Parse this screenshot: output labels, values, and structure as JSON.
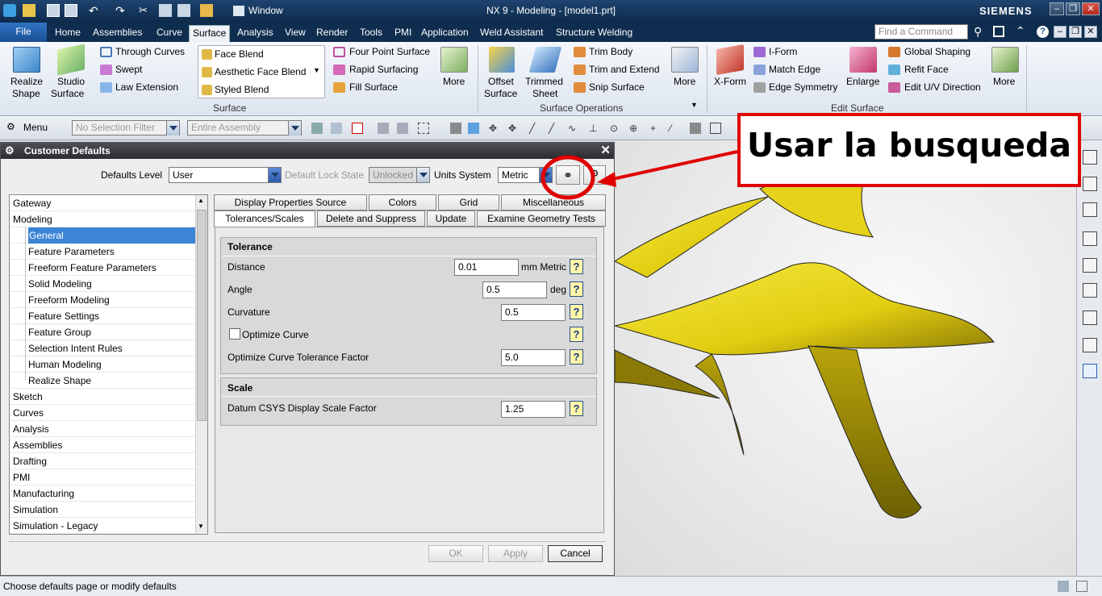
{
  "window": {
    "title": "NX 9 - Modeling - [model1.prt]",
    "brand": "SIEMENS",
    "quick_access_window": "Window"
  },
  "ribbon_tabs": [
    "File",
    "Home",
    "Assemblies",
    "Curve",
    "Surface",
    "Analysis",
    "View",
    "Render",
    "Tools",
    "PMI",
    "Application",
    "Weld Assistant",
    "Structure Welding"
  ],
  "active_tab": "Surface",
  "search": {
    "placeholder": "Find a Command"
  },
  "ribbon": {
    "realize_shape": "Realize",
    "realize_shape_2": "Shape",
    "studio_surface": "Studio",
    "studio_surface_2": "Surface",
    "through_curves": "Through Curves",
    "swept": "Swept",
    "law_extension": "Law Extension",
    "face_blend": "Face Blend",
    "aesthetic_face_blend": "Aesthetic Face Blend",
    "styled_blend": "Styled Blend",
    "four_point_surface": "Four Point Surface",
    "rapid_surfacing": "Rapid Surfacing",
    "fill_surface": "Fill Surface",
    "more1": "More",
    "group_surface": "Surface",
    "offset_surface": "Offset",
    "offset_surface_2": "Surface",
    "trimmed_sheet": "Trimmed",
    "trimmed_sheet_2": "Sheet",
    "trim_body": "Trim Body",
    "trim_and_extend": "Trim and Extend",
    "snip_surface": "Snip Surface",
    "more2": "More",
    "group_surface_operations": "Surface Operations",
    "x_form": "X-Form",
    "i_form": "I-Form",
    "match_edge": "Match Edge",
    "edge_symmetry": "Edge Symmetry",
    "enlarge": "Enlarge",
    "global_shaping": "Global Shaping",
    "refit_face": "Refit Face",
    "edit_uv_direction": "Edit U/V Direction",
    "more3": "More",
    "group_edit_surface": "Edit Surface"
  },
  "toolbar": {
    "menu": "Menu",
    "selection_filter": "No Selection Filter",
    "scope": "Entire Assembly"
  },
  "dialog": {
    "title": "Customer Defaults",
    "defaults_level_label": "Defaults Level",
    "defaults_level_value": "User",
    "lock_state_label": "Default Lock State",
    "lock_state_value": "Unlocked",
    "units_label": "Units System",
    "units_value": "Metric",
    "tree": [
      {
        "label": "Gateway",
        "level": 0
      },
      {
        "label": "Modeling",
        "level": 0
      },
      {
        "label": "General",
        "level": 1,
        "selected": true
      },
      {
        "label": "Feature Parameters",
        "level": 1
      },
      {
        "label": "Freeform Feature Parameters",
        "level": 1
      },
      {
        "label": "Solid Modeling",
        "level": 1
      },
      {
        "label": "Freeform Modeling",
        "level": 1
      },
      {
        "label": "Feature Settings",
        "level": 1
      },
      {
        "label": "Feature Group",
        "level": 1
      },
      {
        "label": "Selection Intent Rules",
        "level": 1
      },
      {
        "label": "Human Modeling",
        "level": 1
      },
      {
        "label": "Realize Shape",
        "level": 1
      },
      {
        "label": "Sketch",
        "level": 0
      },
      {
        "label": "Curves",
        "level": 0
      },
      {
        "label": "Analysis",
        "level": 0
      },
      {
        "label": "Assemblies",
        "level": 0
      },
      {
        "label": "Drafting",
        "level": 0
      },
      {
        "label": "PMI",
        "level": 0
      },
      {
        "label": "Manufacturing",
        "level": 0
      },
      {
        "label": "Simulation",
        "level": 0
      },
      {
        "label": "Simulation - Legacy",
        "level": 0
      }
    ],
    "tabs_row1": [
      "Display Properties Source",
      "Colors",
      "Grid",
      "Miscellaneous"
    ],
    "tabs_row2": [
      "Tolerances/Scales",
      "Delete and Suppress",
      "Update",
      "Examine Geometry Tests"
    ],
    "active_tab": "Tolerances/Scales",
    "tolerance": {
      "title": "Tolerance",
      "distance_label": "Distance",
      "distance_value": "0.01",
      "distance_unit": "mm Metric",
      "angle_label": "Angle",
      "angle_value": "0.5",
      "angle_unit": "deg",
      "curvature_label": "Curvature",
      "curvature_value": "0.5",
      "optimize_curve_label": "Optimize Curve",
      "optimize_factor_label": "Optimize Curve Tolerance Factor",
      "optimize_factor_value": "5.0"
    },
    "scale": {
      "title": "Scale",
      "datum_label": "Datum CSYS Display Scale Factor",
      "datum_value": "1.25"
    },
    "ok": "OK",
    "apply": "Apply",
    "cancel": "Cancel"
  },
  "annotation": {
    "text": "Usar la busqueda",
    "color": "#e00000"
  },
  "status": {
    "text": "Choose defaults page or modify defaults"
  },
  "colors": {
    "surface_yellow": "#f2e21c",
    "title_bar": "#1e4470",
    "selection": "#3d84d4"
  }
}
